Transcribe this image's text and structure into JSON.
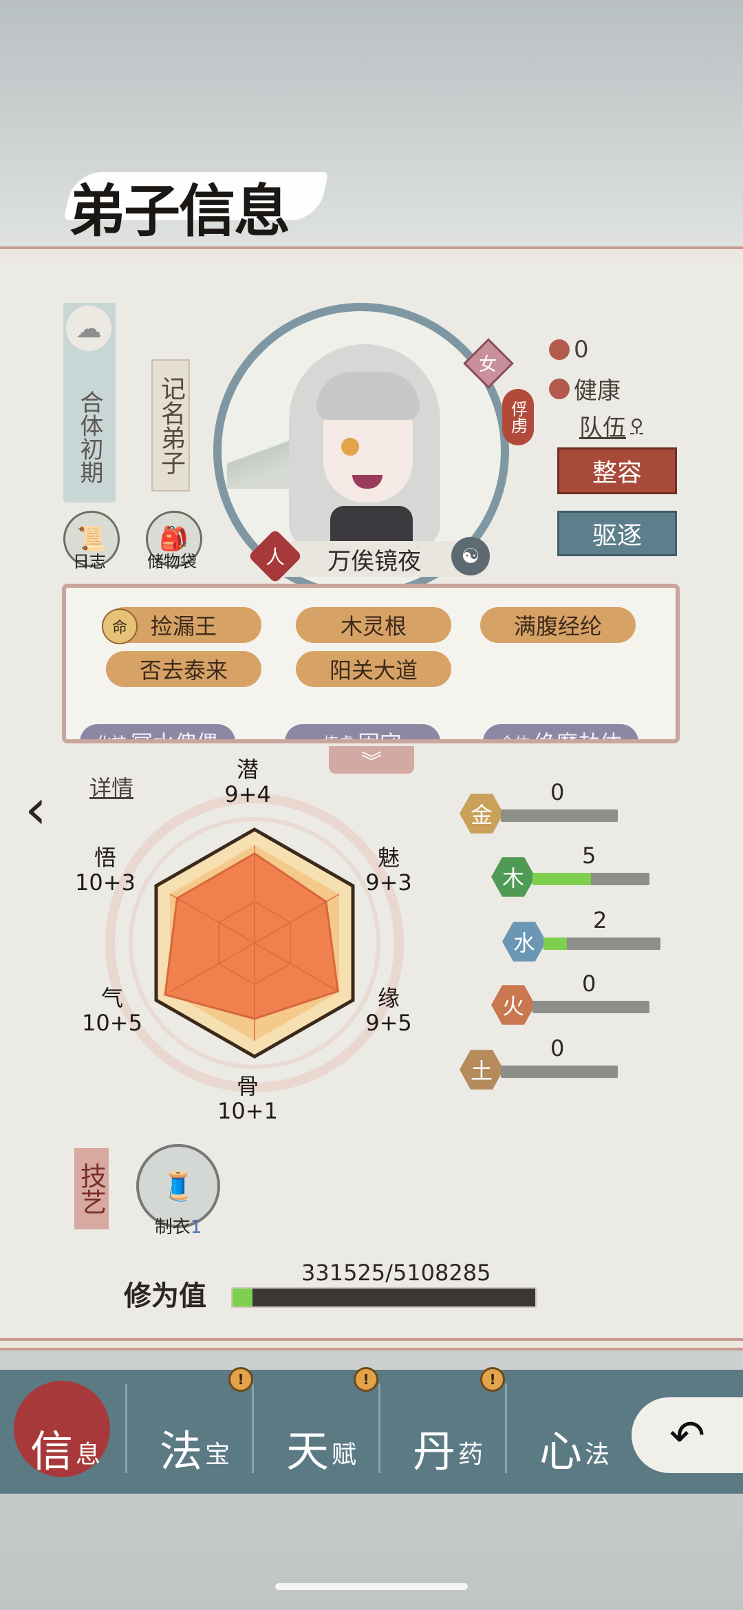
{
  "header": {
    "title": "弟子信息"
  },
  "disciple": {
    "realm": "合体初期",
    "rank": "记名弟子",
    "gender": "女",
    "status_tag": "俘虏",
    "race": "人",
    "name": "万俟镜夜",
    "race_right_icon": "swirl"
  },
  "left_buttons": {
    "log": "日志",
    "bag": "储物袋"
  },
  "status": {
    "count": "0",
    "health": "健康",
    "team": "队伍"
  },
  "actions": {
    "makeover": "整容",
    "expel": "驱逐"
  },
  "traits": {
    "row1": [
      "捡漏王",
      "木灵根",
      "满腹经纶"
    ],
    "row2": [
      "否去泰来",
      "阳关大道"
    ],
    "trait_icon": "命",
    "row3": [
      "冥水傀儡",
      "固守",
      "绝魔劫体"
    ],
    "row3_prefix": [
      "化神",
      "炼虚",
      "合体"
    ]
  },
  "details_label": "详情",
  "attributes": [
    {
      "name": "潜",
      "value": "9+4"
    },
    {
      "name": "魅",
      "value": "9+3"
    },
    {
      "name": "缘",
      "value": "9+5"
    },
    {
      "name": "骨",
      "value": "10+1"
    },
    {
      "name": "气",
      "value": "10+5"
    },
    {
      "name": "悟",
      "value": "10+3"
    }
  ],
  "elements": [
    {
      "name": "金",
      "value": "0",
      "level": 0,
      "color": "#c9a15a"
    },
    {
      "name": "木",
      "value": "5",
      "level": 0.5,
      "color": "#4f9a55"
    },
    {
      "name": "水",
      "value": "2",
      "level": 0.2,
      "color": "#6b97b4"
    },
    {
      "name": "火",
      "value": "0",
      "level": 0,
      "color": "#c9774e"
    },
    {
      "name": "土",
      "value": "0",
      "level": 0,
      "color": "#b58b5c"
    }
  ],
  "skill": {
    "tag": "技艺",
    "name": "制衣",
    "level": "1"
  },
  "cultivation": {
    "label": "修为值",
    "current": "331525/5108285",
    "fraction": 0.065
  },
  "nav": {
    "items": [
      {
        "big": "信",
        "small": "息"
      },
      {
        "big": "法",
        "small": "宝"
      },
      {
        "big": "天",
        "small": "赋"
      },
      {
        "big": "丹",
        "small": "药"
      },
      {
        "big": "心",
        "small": "法"
      }
    ],
    "alert": "!"
  },
  "colors": {
    "accent_red": "#a8393a",
    "nav": "#5c7a84",
    "radar_fill": "#f0814f"
  }
}
